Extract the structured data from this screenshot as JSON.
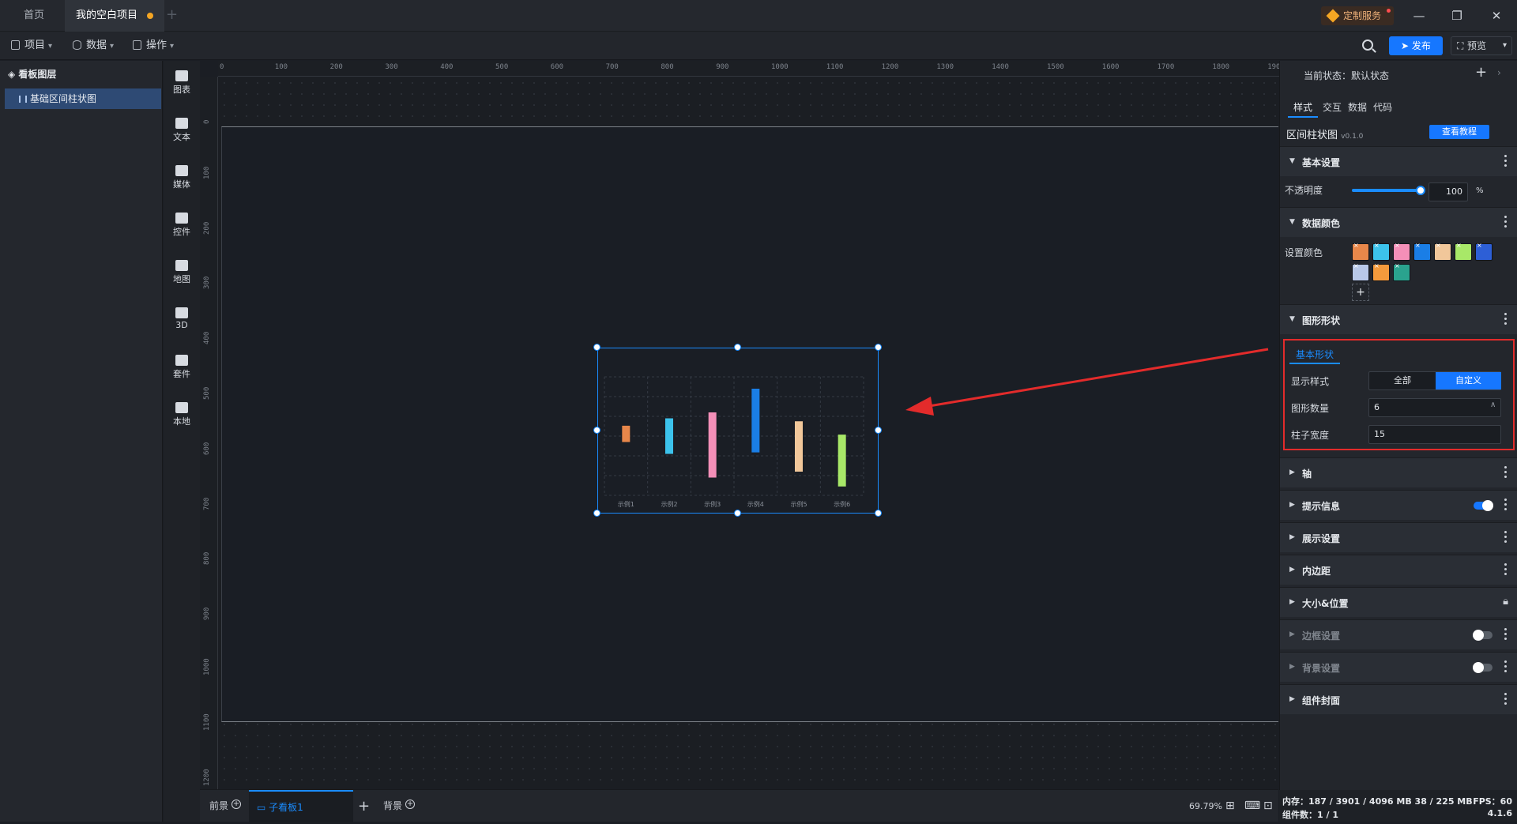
{
  "tabs": [
    {
      "label": "首页"
    },
    {
      "label": "我的空白项目"
    }
  ],
  "custom_service": "定制服务",
  "menu": {
    "project": "项目",
    "data": "数据",
    "ops": "操作"
  },
  "toolbar": {
    "publish": "发布",
    "preview": "预览"
  },
  "layers": {
    "title": "看板图层",
    "items": [
      {
        "label": "基础区间柱状图"
      }
    ]
  },
  "rail": [
    {
      "label": "图表"
    },
    {
      "label": "文本"
    },
    {
      "label": "媒体"
    },
    {
      "label": "控件"
    },
    {
      "label": "地图"
    },
    {
      "label": "3D"
    },
    {
      "label": "套件"
    },
    {
      "label": "本地"
    }
  ],
  "ruler_top": [
    "0",
    "100",
    "200",
    "300",
    "400",
    "500",
    "600",
    "700",
    "800",
    "900",
    "1000",
    "1100",
    "1200",
    "1300",
    "1400",
    "1500",
    "1600",
    "1700",
    "1800",
    "1900"
  ],
  "ruler_left": [
    "0",
    "100",
    "200",
    "300",
    "400",
    "500",
    "600",
    "700",
    "800",
    "900",
    "1000",
    "1100",
    "1200"
  ],
  "chart_data": {
    "type": "bar",
    "categories": [
      "示例1",
      "示例2",
      "示例3",
      "示例4",
      "示例5",
      "示例6"
    ],
    "ranges": [
      [
        -0.2,
        0.35
      ],
      [
        -0.6,
        0.6
      ],
      [
        -1.4,
        0.8
      ],
      [
        -0.55,
        1.6
      ],
      [
        -1.2,
        0.5
      ],
      [
        -1.7,
        0.05
      ]
    ],
    "colors": [
      "#e8874a",
      "#3cc3ec",
      "#f48fb8",
      "#1a7ee6",
      "#f1c79a",
      "#a8e868"
    ]
  },
  "bottom": {
    "front": "前景",
    "sub_board": "子看板1",
    "bg": "背景",
    "zoom": "69.79%"
  },
  "props": {
    "state_label": "当前状态：默认状态",
    "tabs": [
      "样式",
      "交互",
      "数据",
      "代码"
    ],
    "component_name": "区间柱状图",
    "version": "v0.1.0",
    "tutorial": "查看教程",
    "sections": {
      "basic": "基本设置",
      "opacity_label": "不透明度",
      "opacity_value": "100",
      "opacity_unit": "%",
      "data_color": "数据颜色",
      "set_color": "设置颜色",
      "shape": "图形形状",
      "basic_shape": "基本形状",
      "display_style": "显示样式",
      "opt_all": "全部",
      "opt_custom": "自定义",
      "shape_count_label": "图形数量",
      "shape_count": "6",
      "bar_width_label": "柱子宽度",
      "bar_width": "15",
      "axis": "轴",
      "tooltip": "提示信息",
      "display": "展示设置",
      "padding": "内边距",
      "size_pos": "大小&位置",
      "border": "边框设置",
      "background": "背景设置",
      "cover": "组件封面"
    },
    "swatches": [
      "#e8874a",
      "#3cc3ec",
      "#f48fb8",
      "#1a7ee6",
      "#f1c79a",
      "#a8e868",
      "#2d5fd6",
      "#b8c8e8",
      "#f39a3c",
      "#2aa38e"
    ]
  },
  "status": {
    "memory": "内存：187 / 3901 / 4096 MB  38 / 225 MB",
    "fps": "FPS：60",
    "components": "组件数：1 / 1",
    "version": "4.1.6"
  }
}
